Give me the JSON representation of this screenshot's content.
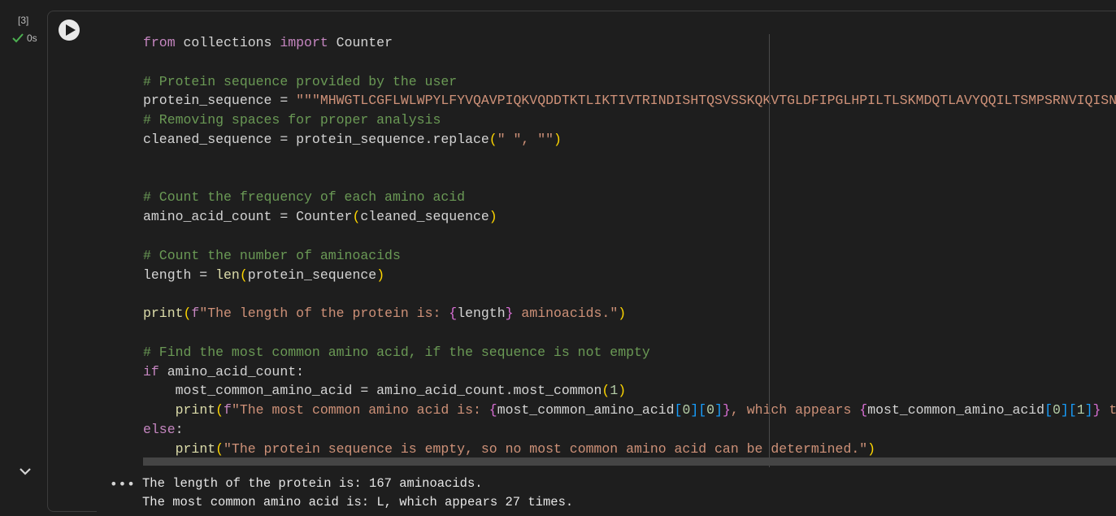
{
  "cell": {
    "execution_count": "[3]",
    "execution_time": "0s",
    "status_color": "#4caf50"
  },
  "code": {
    "line_from": "from",
    "line_collections": " collections ",
    "line_import": "import",
    "line_counter": " Counter",
    "comment_provided": "# Protein sequence provided by the user",
    "protein_var": "protein_sequence = ",
    "protein_value": "\"\"\"MHWGTLCGFLWLWPYLFYVQAVPIQKVQDDTKTLIKTIVTRINDISHTQSVSSKQKVTGLDFIPGLHPILTLSKMDQTLAVYQQILTSMPSRNVIQISNDLENLRDLLH",
    "comment_removing": "# Removing spaces for proper analysis",
    "cleaned_prefix": "cleaned_sequence = protein_sequence.replace",
    "cleaned_open": "(",
    "cleaned_args": "\" \", \"\"",
    "cleaned_close": ")",
    "comment_count_freq": "# Count the frequency of each amino acid",
    "amino_count_prefix": "amino_acid_count = Counter",
    "amino_count_arg": "cleaned_sequence",
    "comment_count_num": "# Count the number of aminoacids",
    "length_prefix": "length = ",
    "length_fn": "len",
    "length_arg": "protein_sequence",
    "print_fn": "print",
    "print1_f": "f",
    "print1_str_a": "\"The length of the protein is: ",
    "print1_var": "length",
    "print1_str_b": " aminoacids.\"",
    "comment_find": "# Find the most common amino acid, if the sequence is not empty",
    "if_kw": "if",
    "if_cond": " amino_acid_count:",
    "indent": "    ",
    "most_common_prefix": "most_common_amino_acid = amino_acid_count.most_common",
    "most_common_arg": "1",
    "print2_str_a": "\"The most common amino acid is: ",
    "print2_var": "most_common_amino_acid",
    "idx0": "0",
    "idx1": "1",
    "print2_str_b": ", which appears ",
    "print2_str_c": " times.\"",
    "else_kw": "else",
    "else_colon": ":",
    "print3_str": "\"The protein sequence is empty, so no most common amino acid can be determined.\""
  },
  "output": {
    "line1": "The length of the protein is: 167 aminoacids.",
    "line2": "The most common amino acid is: L, which appears 27 times.",
    "menu_icon": "•••"
  },
  "icons": {
    "run": "play-icon",
    "status": "check-icon",
    "collapse": "chevron-down-icon",
    "output_menu": "more-horizontal-icon"
  }
}
